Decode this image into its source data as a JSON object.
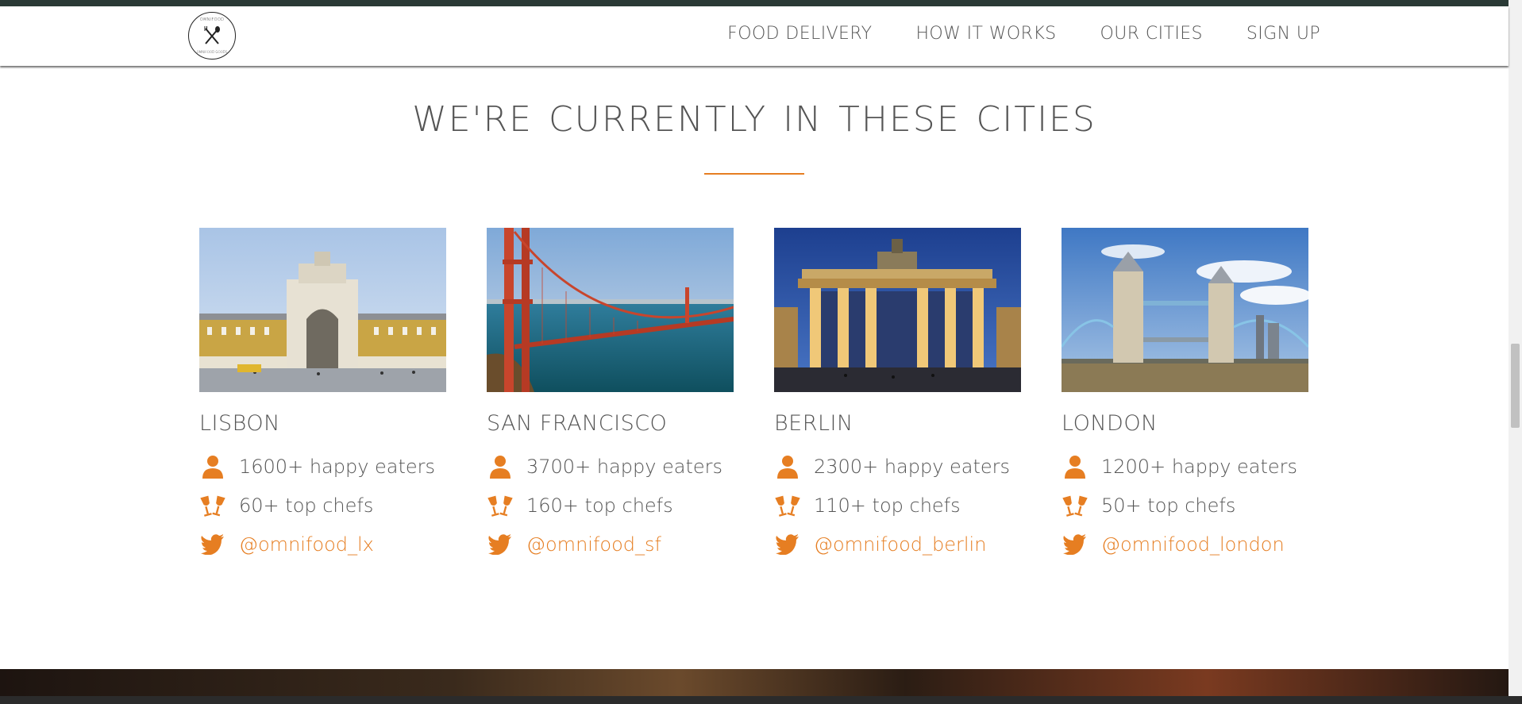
{
  "nav": {
    "logo_text": "OMNIFOOD",
    "logo_subtext": "OMNIFOOD GOODS",
    "links": [
      "FOOD DELIVERY",
      "HOW IT WORKS",
      "OUR CITIES",
      "SIGN UP"
    ]
  },
  "section": {
    "title": "WE'RE CURRENTLY IN THESE CITIES"
  },
  "cities": [
    {
      "name": "LISBON",
      "eaters": "1600+ happy eaters",
      "chefs": "60+ top chefs",
      "twitter": "@omnifood_lx"
    },
    {
      "name": "SAN FRANCISCO",
      "eaters": "3700+ happy eaters",
      "chefs": "160+ top chefs",
      "twitter": "@omnifood_sf"
    },
    {
      "name": "BERLIN",
      "eaters": "2300+ happy eaters",
      "chefs": "110+ top chefs",
      "twitter": "@omnifood_berlin"
    },
    {
      "name": "LONDON",
      "eaters": "1200+ happy eaters",
      "chefs": "50+ top chefs",
      "twitter": "@omnifood_london"
    }
  ],
  "colors": {
    "accent": "#e67e22",
    "text": "#555555",
    "top_strip": "#2a3a36"
  },
  "icons": {
    "person": "person-icon",
    "chefs": "wine-glasses-icon",
    "twitter": "twitter-icon"
  }
}
